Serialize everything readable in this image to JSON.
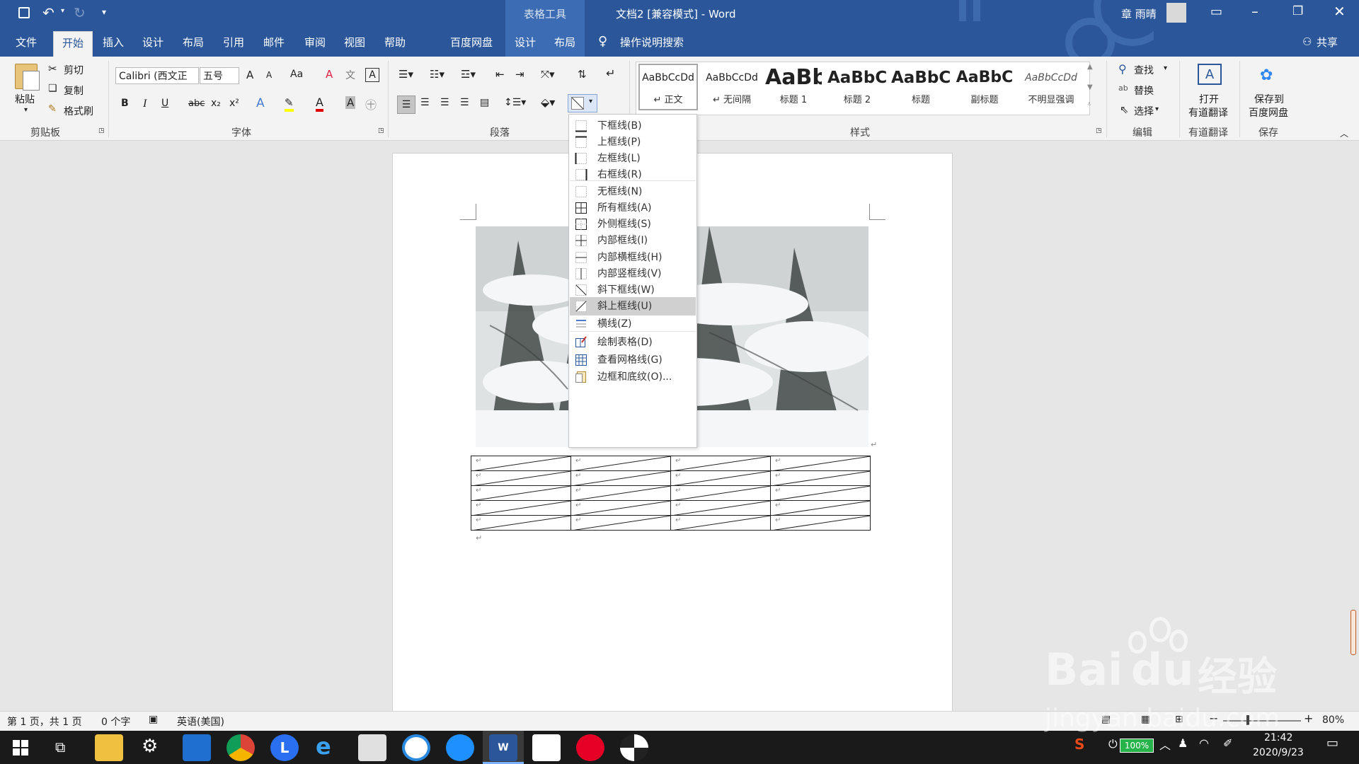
{
  "titlebar": {
    "context_group": "表格工具",
    "doc_title": "文档2 [兼容模式]  -  Word",
    "user_name": "章 雨晴"
  },
  "tabs": {
    "file": "文件",
    "home": "开始",
    "insert": "插入",
    "design": "设计",
    "layout": "布局",
    "references": "引用",
    "mailings": "邮件",
    "review": "审阅",
    "view": "视图",
    "help": "帮助",
    "baidu": "百度网盘",
    "table_design": "设计",
    "table_layout": "布局",
    "tell_me": "操作说明搜索",
    "share": "共享"
  },
  "clipboard": {
    "paste": "粘贴",
    "cut": "剪切",
    "copy": "复制",
    "format_painter": "格式刷",
    "group_label": "剪贴板"
  },
  "font": {
    "font_name": "Calibri (西文正",
    "font_size": "五号",
    "bold": "B",
    "italic": "I",
    "underline": "U",
    "strike": "abc",
    "subscript": "x₂",
    "superscript": "x²",
    "change_case": "Aa",
    "grow": "A",
    "shrink": "A",
    "group_label": "字体"
  },
  "paragraph": {
    "group_label": "段落"
  },
  "styles": {
    "items": [
      {
        "preview": "AaBbCcDd",
        "name": "↵ 正文"
      },
      {
        "preview": "AaBbCcDd",
        "name": "↵ 无间隔"
      },
      {
        "preview": "AaBb",
        "name": "标题 1"
      },
      {
        "preview": "AaBbC(",
        "name": "标题 2"
      },
      {
        "preview": "AaBbC(",
        "name": "标题"
      },
      {
        "preview": "AaBbC",
        "name": "副标题"
      },
      {
        "preview": "AaBbCcDd",
        "name": "不明显强调"
      }
    ],
    "group_label": "样式"
  },
  "editing": {
    "find": "查找",
    "replace": "替换",
    "select": "选择",
    "group_label": "编辑"
  },
  "youdao": {
    "open_line1": "打开",
    "open_line2": "有道翻译",
    "group_label": "有道翻译"
  },
  "save": {
    "line1": "保存到",
    "line2": "百度网盘",
    "group_label": "保存"
  },
  "border_menu": {
    "items": [
      {
        "label": "下框线(B)",
        "icon": "border-bottom-icon"
      },
      {
        "label": "上框线(P)",
        "icon": "border-top-icon"
      },
      {
        "label": "左框线(L)",
        "icon": "border-left-icon"
      },
      {
        "label": "右框线(R)",
        "icon": "border-right-icon"
      },
      {
        "label": "无框线(N)",
        "icon": "border-none-icon"
      },
      {
        "label": "所有框线(A)",
        "icon": "border-all-icon"
      },
      {
        "label": "外侧框线(S)",
        "icon": "border-outside-icon"
      },
      {
        "label": "内部框线(I)",
        "icon": "border-inside-icon"
      },
      {
        "label": "内部横框线(H)",
        "icon": "border-inside-h-icon"
      },
      {
        "label": "内部竖框线(V)",
        "icon": "border-inside-v-icon"
      },
      {
        "label": "斜下框线(W)",
        "icon": "diag-down-icon"
      },
      {
        "label": "斜上框线(U)",
        "icon": "diag-up-icon"
      },
      {
        "label": "横线(Z)",
        "icon": "horizontal-line-icon"
      },
      {
        "label": "绘制表格(D)",
        "icon": "draw-table-icon"
      },
      {
        "label": "查看网格线(G)",
        "icon": "view-gridlines-icon"
      },
      {
        "label": "边框和底纹(O)...",
        "icon": "borders-shading-icon"
      }
    ],
    "highlighted": "斜上框线(U)"
  },
  "table": {
    "rows": 5,
    "cols": 4,
    "cell_mark": "↵"
  },
  "paragraph_mark": "↵",
  "statusbar": {
    "page": "第 1 页，共 1 页",
    "words": "0 个字",
    "language": "英语(美国)",
    "zoom": "80%"
  },
  "taskbar": {
    "battery": "100%",
    "time": "21:42",
    "date": "2020/9/23"
  },
  "watermark": {
    "brand": "Bai",
    "brand2": "du",
    "suffix": "经验",
    "url": "jingyan.baidu.com"
  },
  "colors": {
    "word_blue": "#2b579a",
    "highlight": "#d0d0d0",
    "font_red": "#e00000",
    "highlight_yellow": "#ffff00"
  }
}
